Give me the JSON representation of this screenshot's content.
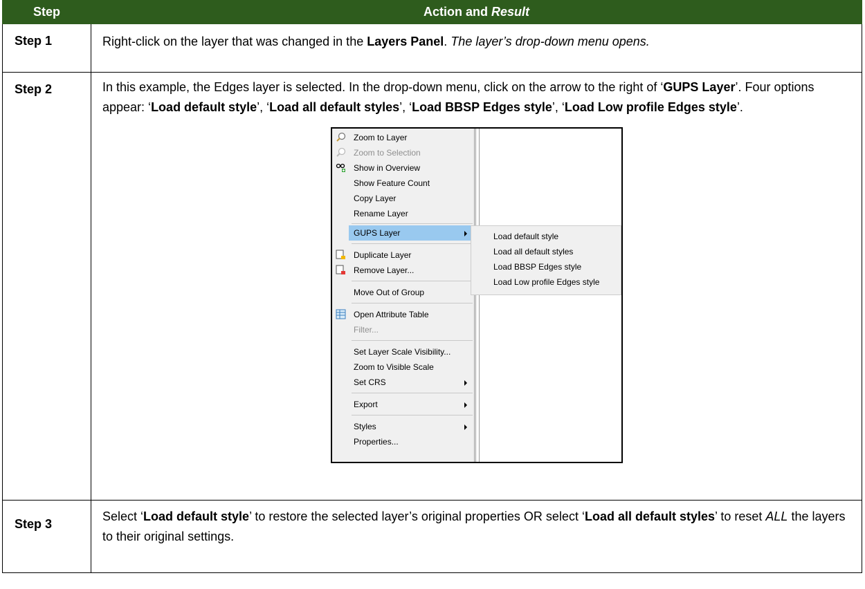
{
  "table": {
    "header": {
      "step": "Step",
      "action_prefix": "Action and ",
      "action_suffix": "Result"
    },
    "rows": [
      {
        "step": "Step 1",
        "t1": "Right-click on the layer that was changed in the ",
        "b1": "Layers Panel",
        "t2": ". ",
        "i1": "The layer’s drop-down menu opens."
      },
      {
        "step": "Step 2",
        "t1": "In this example, the Edges layer is selected. In the drop-down menu, click on the arrow to the right of ‘",
        "b1": "GUPS Layer",
        "t2": "’. Four options appear: ‘",
        "b2": "Load default style",
        "t3": "’, ‘",
        "b3": "Load all default styles",
        "t4": "’, ‘",
        "b4": "Load BBSP Edges style",
        "t5": "’, ‘",
        "b5": "Load Low profile Edges style",
        "t6": "’."
      },
      {
        "step": "Step 3",
        "t1": "Select ‘",
        "b1": "Load default style",
        "t2": "’ to restore the selected layer’s original properties OR select ‘",
        "b2": "Load all default styles",
        "t3": "’ to reset ",
        "i1": "ALL",
        "t4": " the layers to their original settings."
      }
    ]
  },
  "context_menu": {
    "items": {
      "zoom_to_layer": "Zoom to Layer",
      "zoom_to_selection": "Zoom to Selection",
      "show_in_overview": "Show in Overview",
      "show_feature_count": "Show Feature Count",
      "copy_layer": "Copy Layer",
      "rename_layer": "Rename Layer",
      "gups_layer": "GUPS Layer",
      "duplicate_layer": "Duplicate Layer",
      "remove_layer": "Remove Layer...",
      "move_out_of_group": "Move Out of Group",
      "open_attribute_table": "Open Attribute Table",
      "filter": "Filter...",
      "set_layer_scale_visibility": "Set Layer Scale Visibility...",
      "zoom_to_visible_scale": "Zoom to Visible Scale",
      "set_crs": "Set CRS",
      "export": "Export",
      "styles": "Styles",
      "properties": "Properties..."
    },
    "submenu": [
      "Load default style",
      "Load all default styles",
      "Load BBSP Edges style",
      "Load Low profile Edges style"
    ],
    "highlight_color": "#99c9ef"
  },
  "colors": {
    "header_bg": "#2e5c1d",
    "header_text": "#ffffff"
  }
}
